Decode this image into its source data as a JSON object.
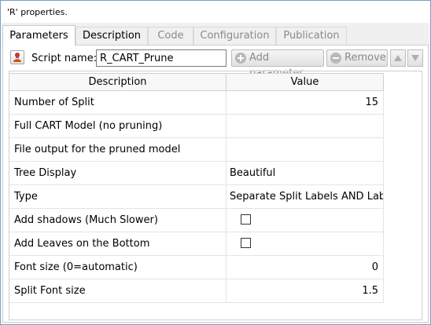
{
  "window": {
    "title": "'R' properties."
  },
  "tabs": [
    {
      "label": "Parameters",
      "active": true,
      "enabled": true
    },
    {
      "label": "Description",
      "active": false,
      "enabled": true
    },
    {
      "label": "Code",
      "active": false,
      "enabled": false
    },
    {
      "label": "Configuration",
      "active": false,
      "enabled": false
    },
    {
      "label": "Publication",
      "active": false,
      "enabled": false
    }
  ],
  "toolbar": {
    "script_label": "Script name:",
    "script_name": "R_CART_Prune",
    "add_label": "Add parameter",
    "remove_label": "Remove",
    "icons": {
      "script": "script-icon",
      "add": "plus-circle-icon",
      "remove": "minus-circle-icon",
      "up": "arrow-up-icon",
      "down": "arrow-down-icon"
    }
  },
  "table": {
    "headers": {
      "description": "Description",
      "value": "Value"
    },
    "rows": [
      {
        "description": "Number of Split",
        "value": "15",
        "kind": "number"
      },
      {
        "description": "Full CART Model (no pruning)",
        "value": "",
        "kind": "text"
      },
      {
        "description": "File output for the pruned model",
        "value": "",
        "kind": "text"
      },
      {
        "description": "Tree Display",
        "value": "Beautiful",
        "kind": "text"
      },
      {
        "description": "Type",
        "value": "Separate Split Labels AND Lab...",
        "kind": "text"
      },
      {
        "description": "Add shadows (Much Slower)",
        "value": "",
        "kind": "checkbox",
        "checked": false
      },
      {
        "description": "Add Leaves on the Bottom",
        "value": "",
        "kind": "checkbox",
        "checked": false
      },
      {
        "description": "Font size (0=automatic)",
        "value": "0",
        "kind": "number"
      },
      {
        "description": "Split Font size",
        "value": "1.5",
        "kind": "number"
      }
    ]
  }
}
